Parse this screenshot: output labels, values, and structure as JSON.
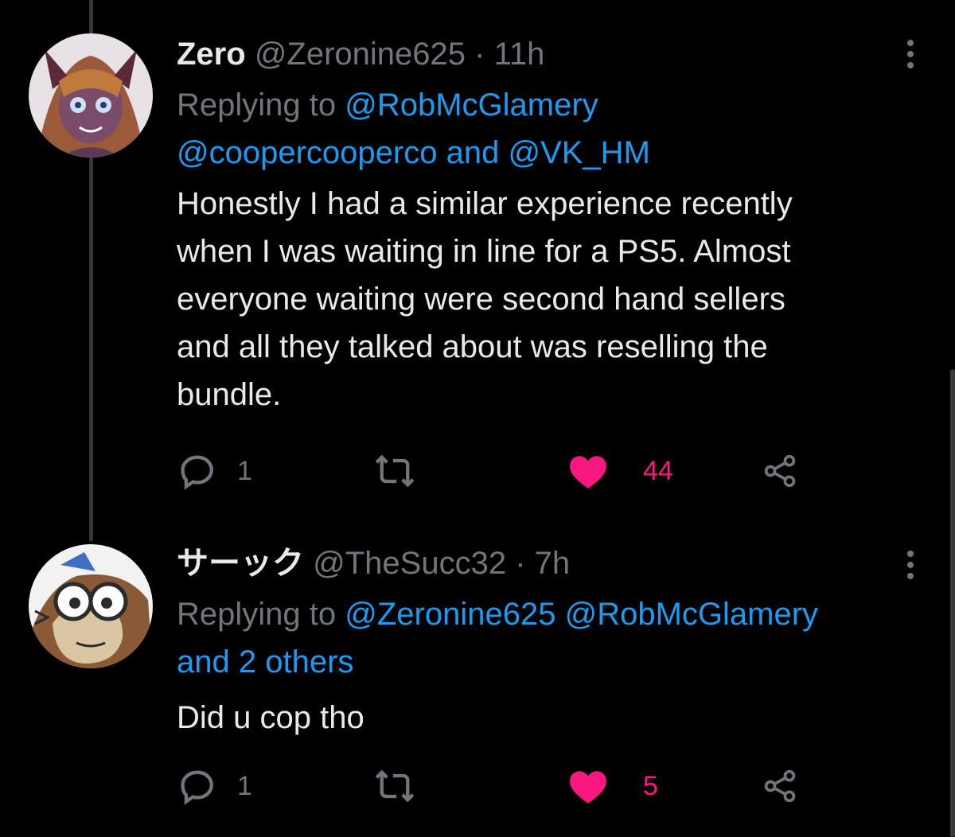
{
  "tweets": [
    {
      "display_name": "Zero",
      "handle": "@Zeronine625",
      "separator": "·",
      "time": "11h",
      "replying_prefix": "Replying to",
      "replying_line1_mention": "@RobMcGlamery",
      "replying_line2_mention_a": "@coopercooperco",
      "replying_line2_and": "and",
      "replying_line2_mention_b": "@VK_HM",
      "text_lines": [
        "Honestly I had a similar experience recently",
        "when I was waiting in line for a PS5. Almost",
        "everyone waiting were second hand sellers",
        "and all they talked about was reselling the",
        "bundle."
      ],
      "reply_count": "1",
      "like_count": "44"
    },
    {
      "display_name": "サーック",
      "handle": "@TheSucc32",
      "separator": "·",
      "time": "7h",
      "replying_prefix": "Replying to",
      "replying_line1_mention_a": "@Zeronine625",
      "replying_line1_mention_b": "@RobMcGlamery",
      "replying_line2": "and 2 others",
      "text_lines": [
        "Did u cop tho"
      ],
      "reply_count": "1",
      "like_count": "5"
    }
  ],
  "colors": {
    "background": "#000000",
    "text": "#e7e9ea",
    "muted": "#71767b",
    "link": "#1d9bf0",
    "like": "#f91880"
  },
  "icons": [
    "reply-icon",
    "retweet-icon",
    "like-icon",
    "share-icon",
    "more-icon"
  ]
}
